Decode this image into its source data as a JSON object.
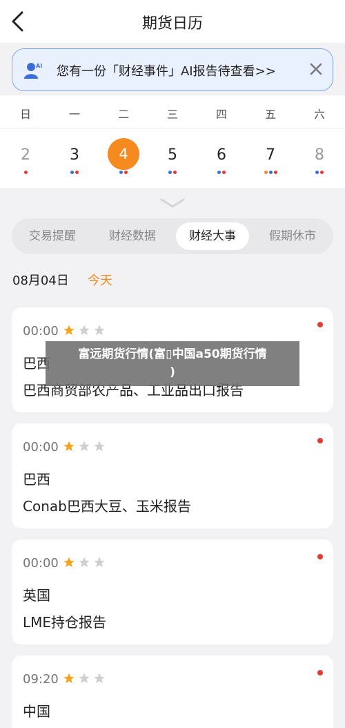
{
  "header": {
    "title": "期货日历"
  },
  "notice": {
    "text": "您有一份「财经事件」AI报告待查看>>"
  },
  "calendar": {
    "weekdays": [
      "日",
      "一",
      "二",
      "三",
      "四",
      "五",
      "六"
    ],
    "days": [
      "2",
      "3",
      "4",
      "5",
      "6",
      "7",
      "8"
    ],
    "selected_index": 2,
    "dot_colors": [
      [
        "#e53935"
      ],
      [
        "#3b6fd8",
        "#e53935"
      ],
      [
        "#3b6fd8",
        "#e53935"
      ],
      [
        "#3b6fd8",
        "#e53935"
      ],
      [
        "#3b6fd8",
        "#e53935"
      ],
      [
        "#f58a1f",
        "#3b6fd8",
        "#e53935"
      ],
      [
        "#3b6fd8",
        "#e53935"
      ]
    ]
  },
  "tabs": [
    "交易提醒",
    "财经数据",
    "财经大事",
    "假期休市"
  ],
  "active_tab": 2,
  "date": {
    "label": "08月04日",
    "today": "今天"
  },
  "events": [
    {
      "time": "00:00",
      "stars": 1,
      "country": "巴西",
      "title": "巴西商贸部农产品、工业品出口报告"
    },
    {
      "time": "00:00",
      "stars": 1,
      "country": "巴西",
      "title": "Conab巴西大豆、玉米报告"
    },
    {
      "time": "00:00",
      "stars": 1,
      "country": "英国",
      "title": "LME持仓报告"
    },
    {
      "time": "09:20",
      "stars": 1,
      "country": "中国",
      "title": ""
    }
  ],
  "overlay": {
    "line1": "富远期货行情(富▯中国a50期货行情",
    "line2": ")"
  },
  "colors": {
    "accent": "#f58a1f",
    "star_on": "#f5a623",
    "star_off": "#cfcfcf",
    "alert": "#e53935"
  }
}
